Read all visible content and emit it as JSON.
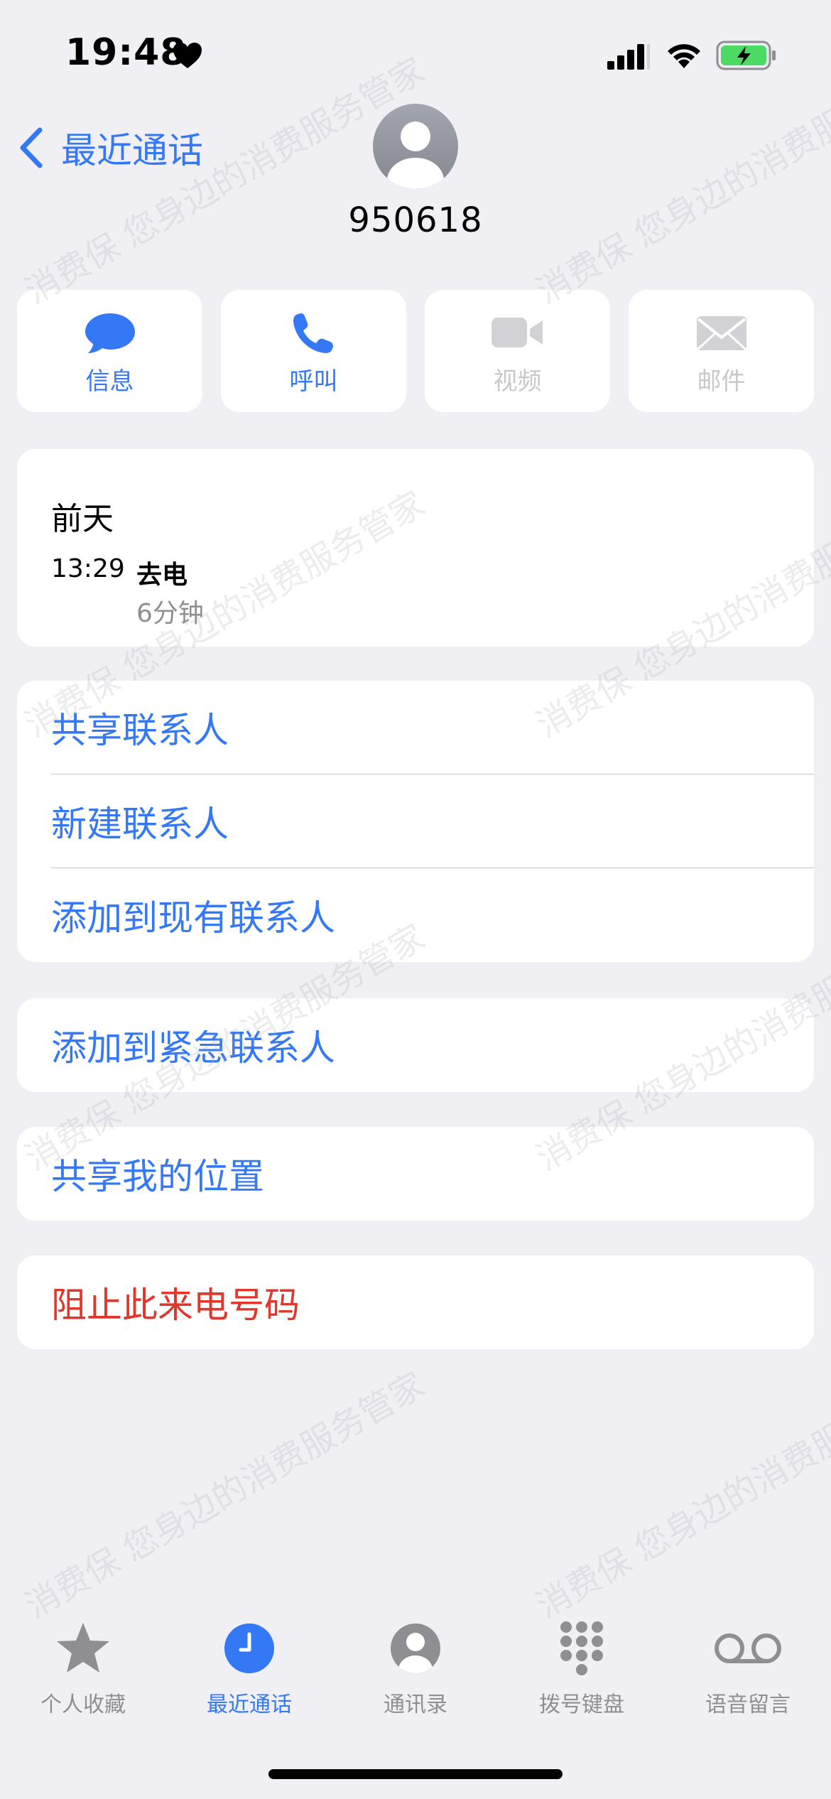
{
  "status_bar": {
    "time": "19:48"
  },
  "header": {
    "back_label": "最近通话",
    "contact_number": "950618"
  },
  "actions": [
    {
      "label": "信息",
      "icon": "message-bubble-icon",
      "enabled": true
    },
    {
      "label": "呼叫",
      "icon": "phone-icon",
      "enabled": true
    },
    {
      "label": "视频",
      "icon": "video-camera-icon",
      "enabled": false
    },
    {
      "label": "邮件",
      "icon": "envelope-icon",
      "enabled": false
    }
  ],
  "call_history": {
    "day": "前天",
    "time": "13:29",
    "type": "去电",
    "duration": "6分钟"
  },
  "contact_options": {
    "share_contact": "共享联系人",
    "create_contact": "新建联系人",
    "add_to_existing": "添加到现有联系人"
  },
  "emergency": {
    "add_to_emergency": "添加到紧急联系人"
  },
  "location": {
    "share_location": "共享我的位置"
  },
  "block": {
    "block_caller": "阻止此来电号码"
  },
  "tabs": [
    {
      "label": "个人收藏",
      "icon": "star-icon",
      "active": false
    },
    {
      "label": "最近通话",
      "icon": "clock-icon",
      "active": true
    },
    {
      "label": "通讯录",
      "icon": "person-circle-icon",
      "active": false
    },
    {
      "label": "拨号键盘",
      "icon": "keypad-icon",
      "active": false
    },
    {
      "label": "语音留言",
      "icon": "voicemail-icon",
      "active": false
    }
  ],
  "watermark": {
    "text": "消费保 您身边的消费服务管家"
  },
  "colors": {
    "accent": "#3478f6",
    "danger": "#e0362c",
    "background": "#efeff4",
    "battery": "#4cd964"
  }
}
